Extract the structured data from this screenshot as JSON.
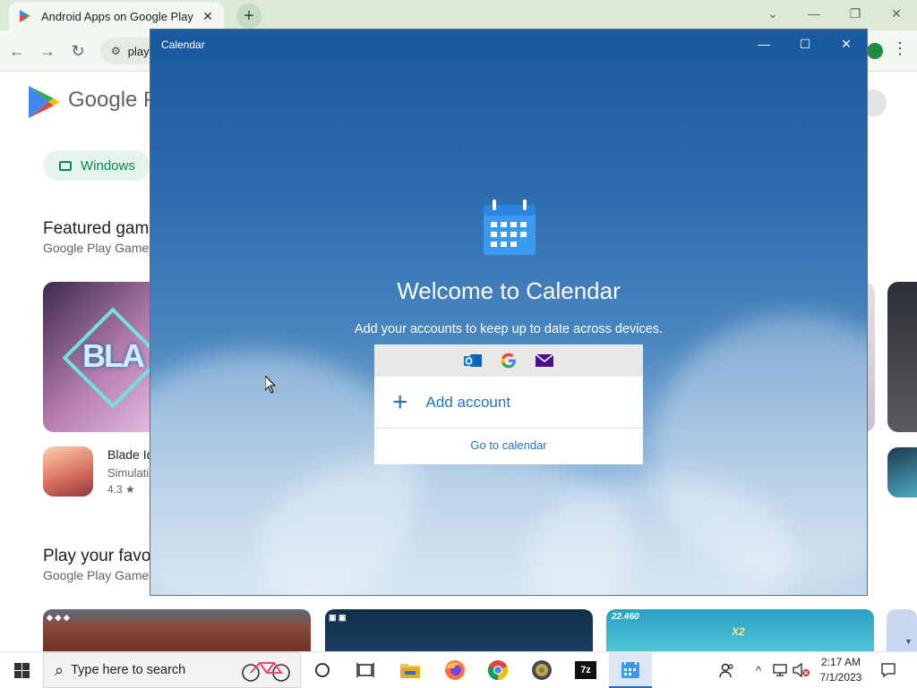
{
  "browser": {
    "tab_title": "Android Apps on Google Play",
    "tab_close": "✕",
    "new_tab": "+",
    "url_partial": "play",
    "window_controls": [
      "⌄",
      "—",
      "❐",
      "✕"
    ],
    "nav": {
      "back": "←",
      "forward": "→",
      "reload": "↻"
    }
  },
  "play": {
    "brand": "Google P",
    "chip_label": "Windows",
    "section1_title": "Featured game",
    "section1_sub": "Google Play Games",
    "app_name": "Blade Id",
    "app_category": "Simulatio",
    "app_rating": "4.3 ★",
    "section2_title": "Play your favo",
    "section2_sub": "Google Play Games",
    "thumb3_score": "22.460",
    "thumb3_mult": "X2"
  },
  "calendar": {
    "window_title": "Calendar",
    "controls": [
      "—",
      "☐",
      "✕"
    ],
    "welcome": "Welcome to Calendar",
    "subline": "Add your accounts to keep up to date across devices.",
    "account_icons": [
      "outlook-icon",
      "google-icon",
      "mail-icon"
    ],
    "add_account": "Add account",
    "go_to_calendar": "Go to calendar"
  },
  "taskbar": {
    "search_placeholder": "Type here to search",
    "pinned": [
      "cortana-icon",
      "task-view-icon",
      "file-explorer-icon",
      "firefox-icon",
      "chrome-icon",
      "app-icon",
      "7zip-icon",
      "calendar-icon"
    ],
    "seven_zip_label": "7z",
    "time": "2:17 AM",
    "date": "7/1/2023"
  },
  "colors": {
    "accent": "#1f73c9",
    "calendar_titlebar": "#1a5a9f",
    "play_green": "#01875f",
    "chrome_frame": "#dbe9d6"
  }
}
